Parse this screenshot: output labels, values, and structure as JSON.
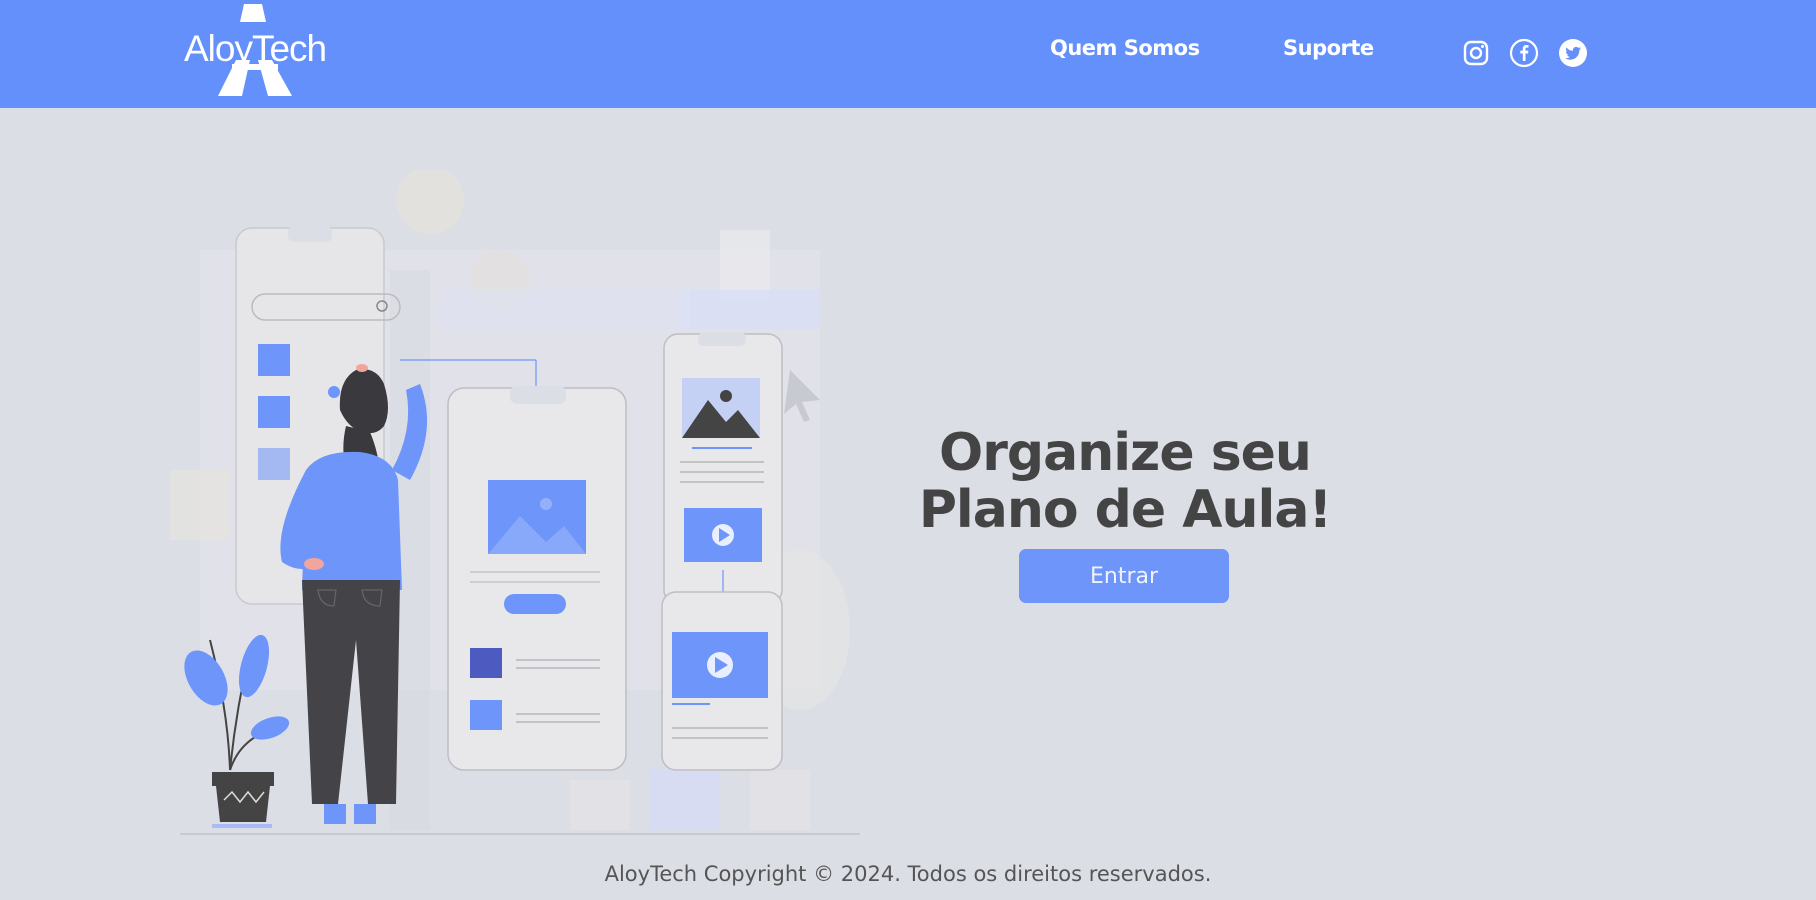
{
  "header": {
    "brand": "AloyTech",
    "nav": {
      "about": "Quem Somos",
      "support": "Suporte"
    },
    "social": [
      "instagram-icon",
      "facebook-icon",
      "twitter-icon"
    ]
  },
  "hero": {
    "title_line1": "Organize seu",
    "title_line2": "Plano de Aula!",
    "button": "Entrar"
  },
  "footer": {
    "copyright": "AloyTech Copyright © 2024. Todos os direitos reservados."
  },
  "colors": {
    "header_bg": "#6490fc",
    "page_bg": "#dcdee6",
    "accent": "#6e95fa",
    "dark": "#444444"
  }
}
